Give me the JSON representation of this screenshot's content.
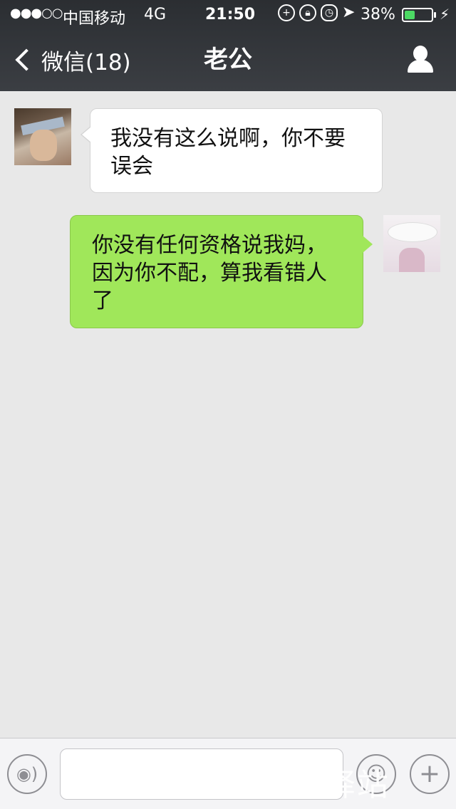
{
  "status_bar": {
    "signal": "●●●○○",
    "carrier": "中国移动",
    "network": "4G",
    "time": "21:50",
    "battery_percent": "38%",
    "battery_level": 0.38,
    "icons": [
      "sync-icon",
      "orientation-lock-icon",
      "alarm-icon",
      "location-icon"
    ],
    "charging_icon": "⚡"
  },
  "nav": {
    "back_label": "微信(18)",
    "title": "老公",
    "profile_icon": "profile-icon"
  },
  "messages": [
    {
      "side": "left",
      "text": "我没有这么说啊，你不要误会"
    },
    {
      "side": "right",
      "text": "你没有任何资格说我妈，因为你不配，算我看错人了"
    }
  ],
  "input_bar": {
    "voice_icon": "voice-icon",
    "input_value": "",
    "emoji_icon": "emoji-icon",
    "plus_icon": "plus-icon"
  },
  "watermark": "快传号 / 情感门驿站",
  "colors": {
    "nav_bg": "#2b2e32",
    "chat_bg": "#e8e8e8",
    "outgoing_bubble": "#a0e75a",
    "incoming_bubble": "#ffffff",
    "battery_fill": "#4cd964"
  }
}
